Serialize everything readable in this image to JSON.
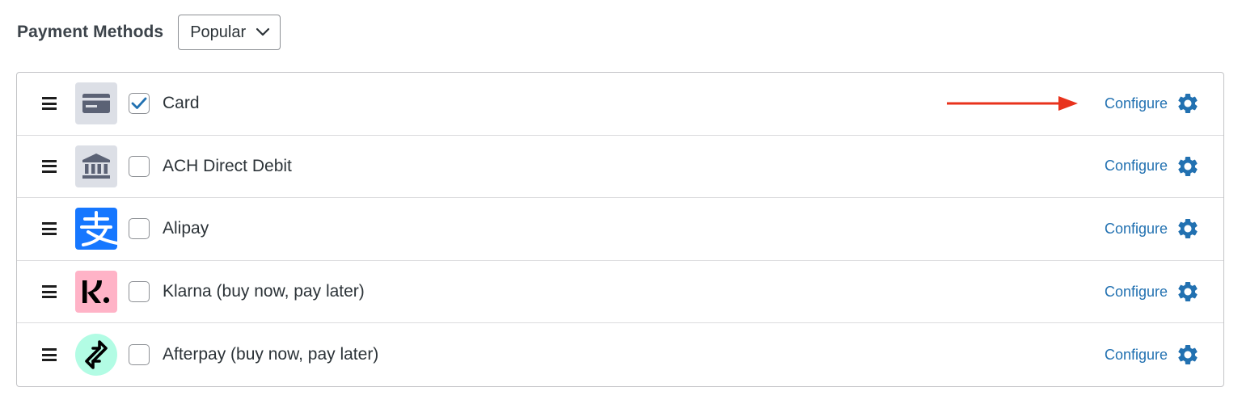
{
  "header": {
    "title": "Payment Methods",
    "filter": {
      "selected": "Popular"
    }
  },
  "methods": [
    {
      "label": "Card",
      "icon": "credit-card-icon",
      "checked": true,
      "configure_label": "Configure"
    },
    {
      "label": "ACH Direct Debit",
      "icon": "bank-icon",
      "checked": false,
      "configure_label": "Configure"
    },
    {
      "label": "Alipay",
      "icon": "alipay-icon",
      "checked": false,
      "configure_label": "Configure"
    },
    {
      "label": "Klarna (buy now, pay later)",
      "icon": "klarna-icon",
      "checked": false,
      "configure_label": "Configure"
    },
    {
      "label": "Afterpay (buy now, pay later)",
      "icon": "afterpay-icon",
      "checked": false,
      "configure_label": "Configure"
    }
  ],
  "colors": {
    "link": "#2271b1",
    "annotation_arrow": "#e8321c",
    "alipay_blue": "#1677ff",
    "klarna_pink": "#ffb3c7",
    "afterpay_mint": "#b2fce4",
    "neutral_tile": "#dcdfe6"
  },
  "annotation": {
    "type": "arrow",
    "points_to": "Card Configure link"
  }
}
